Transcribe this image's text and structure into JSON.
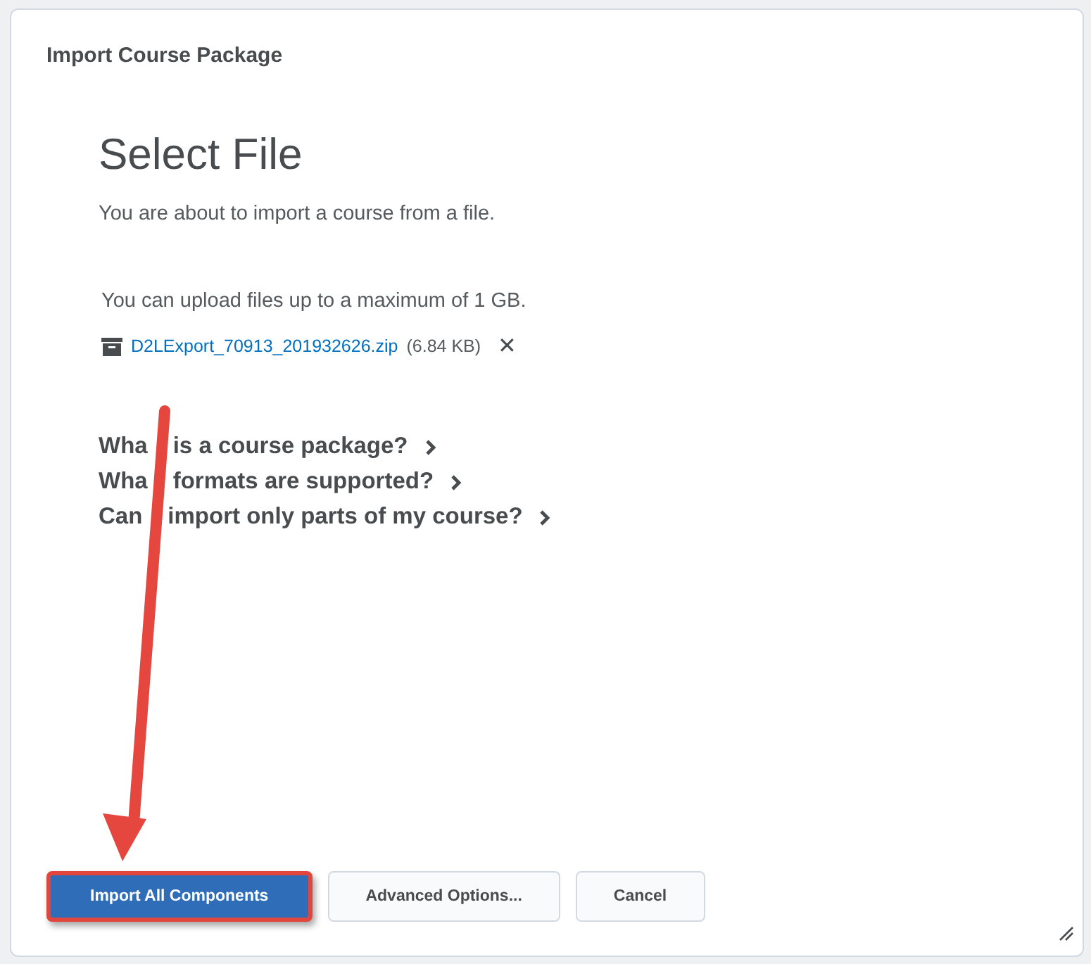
{
  "dialog": {
    "title": "Import Course Package"
  },
  "heading": "Select File",
  "intro": "You are about to import a course from a file.",
  "upload_limit": "You can upload files up to a maximum of 1 GB.",
  "file": {
    "name": "D2LExport_70913_201932626.zip",
    "size": "(6.84 KB)",
    "remove": "✕"
  },
  "help_links": [
    {
      "label_start": "Wha",
      "label_end": "is a course package?"
    },
    {
      "label_start": "Wha",
      "label_end": "formats are supported?"
    },
    {
      "label_start": "Can",
      "label_end": "import only parts of my course?"
    }
  ],
  "buttons": [
    {
      "label": "Import All Components",
      "kind": "primary",
      "highlighted": true
    },
    {
      "label": "Advanced Options...",
      "kind": "secondary",
      "highlighted": false
    },
    {
      "label": "Cancel",
      "kind": "secondary",
      "highlighted": false
    }
  ]
}
